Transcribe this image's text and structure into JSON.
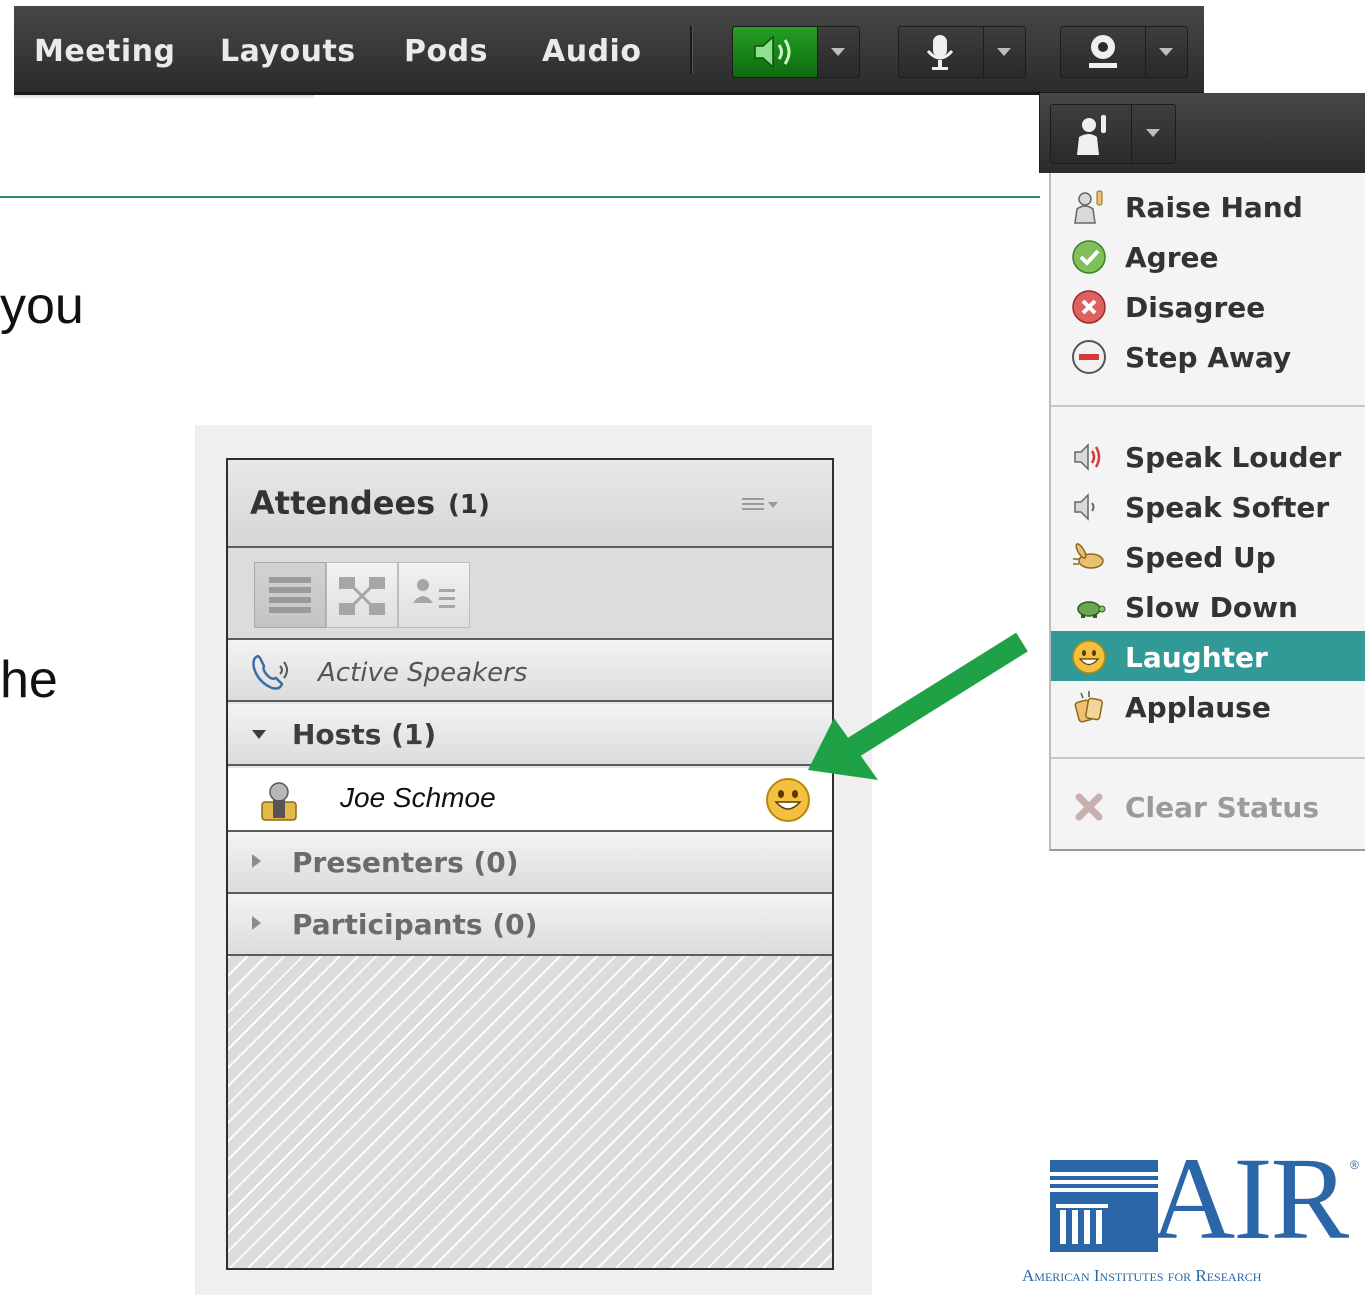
{
  "menubar": {
    "items": [
      "Meeting",
      "Layouts",
      "Pods",
      "Audio"
    ]
  },
  "slide": {
    "fragment_1": "you",
    "fragment_2": "he"
  },
  "attendees_pod": {
    "title": "Attendees",
    "count": "(1)",
    "active_speakers": "Active Speakers",
    "hosts_label": "Hosts (1)",
    "host_name": "Joe Schmoe",
    "presenters_label": "Presenters (0)",
    "participants_label": "Participants (0)"
  },
  "status_menu": {
    "group_1": [
      "Raise Hand",
      "Agree",
      "Disagree",
      "Step Away"
    ],
    "group_2": [
      "Speak Louder",
      "Speak Softer",
      "Speed Up",
      "Slow Down",
      "Laughter",
      "Applause"
    ],
    "clear": "Clear Status",
    "highlighted": "Laughter"
  },
  "logo": {
    "name": "AIR",
    "subtitle": "American Institutes for Research",
    "reg": "®"
  },
  "colors": {
    "menubar": "#333333",
    "accent_green": "#1fa146",
    "highlight_teal": "#329a96",
    "logo_blue": "#2a66a8",
    "rule": "#2e8d6e"
  }
}
